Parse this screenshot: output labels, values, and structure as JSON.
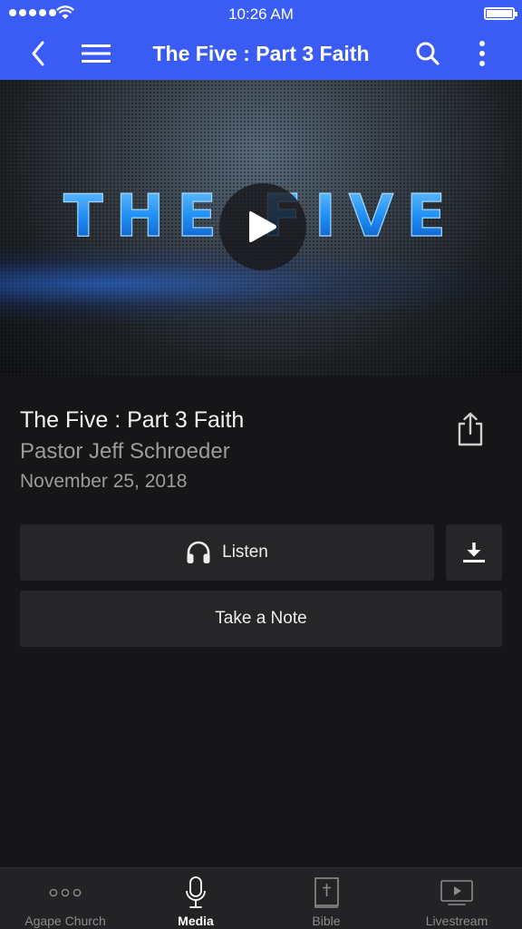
{
  "status_bar": {
    "time": "10:26 AM"
  },
  "nav": {
    "title": "The Five : Part 3 Faith"
  },
  "hero": {
    "artwork_text": "THE FIVE"
  },
  "sermon": {
    "title": "The Five : Part 3 Faith",
    "speaker": "Pastor Jeff Schroeder",
    "date": "November 25, 2018"
  },
  "actions": {
    "listen_label": "Listen",
    "take_note_label": "Take a Note"
  },
  "tabs": [
    {
      "label": "Agape Church",
      "icon": "more-dots-icon",
      "active": false
    },
    {
      "label": "Media",
      "icon": "microphone-icon",
      "active": true
    },
    {
      "label": "Bible",
      "icon": "bible-icon",
      "active": false
    },
    {
      "label": "Livestream",
      "icon": "livestream-icon",
      "active": false
    }
  ],
  "colors": {
    "accent": "#3b5bf5",
    "background": "#161618",
    "button": "#262628",
    "tab_bar": "#232325"
  }
}
